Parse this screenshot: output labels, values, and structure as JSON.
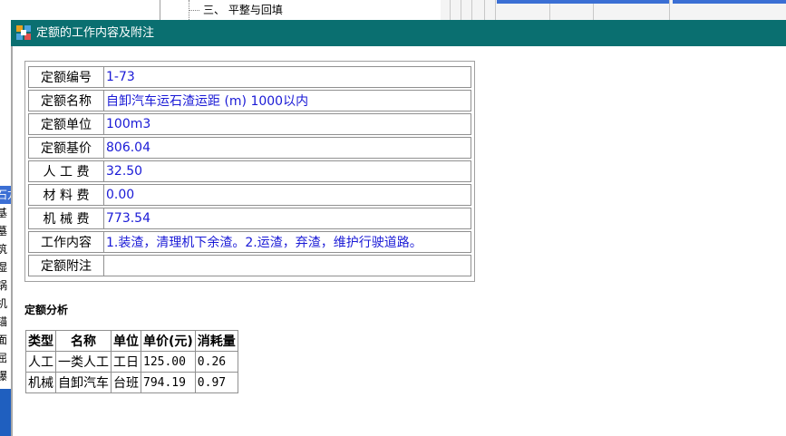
{
  "background": {
    "tree_text": "三、    平整与回填",
    "left_strip_chars": [
      "石方",
      "基",
      "墓",
      "筑",
      "湿",
      "锅",
      "机",
      "锚",
      "面",
      "屈",
      "爆",
      "宝",
      "邮"
    ]
  },
  "dialog": {
    "title": "定额的工作内容及附注",
    "title_bar_color": "#0a6f70"
  },
  "info": {
    "rows": [
      {
        "label": "定额编号",
        "value": "1-73"
      },
      {
        "label": "定额名称",
        "value": "自卸汽车运石渣运距 (m) 1000以内"
      },
      {
        "label": "定额单位",
        "value": "100m3"
      },
      {
        "label": "定额基价",
        "value": "806.04"
      },
      {
        "label": "人 工 费",
        "value": "32.50"
      },
      {
        "label": "材 料 费",
        "value": "0.00"
      },
      {
        "label": "机 械 费",
        "value": "773.54"
      },
      {
        "label": "工作内容",
        "value": "1.装渣，清理机下余渣。2.运渣，弃渣，维护行驶道路。"
      },
      {
        "label": "定额附注",
        "value": ""
      }
    ]
  },
  "analysis": {
    "title": "定额分析",
    "headers": [
      "类型",
      "名称",
      "单位",
      "单价(元)",
      "消耗量"
    ],
    "rows": [
      [
        "人工",
        "一类人工",
        "工日",
        "125.00",
        "0.26"
      ],
      [
        "机械",
        "自卸汽车",
        "台班",
        "794.19",
        "0.97"
      ]
    ]
  },
  "colors": {
    "value_text": "#1a1ad6",
    "accent": "#3b6fd4"
  }
}
